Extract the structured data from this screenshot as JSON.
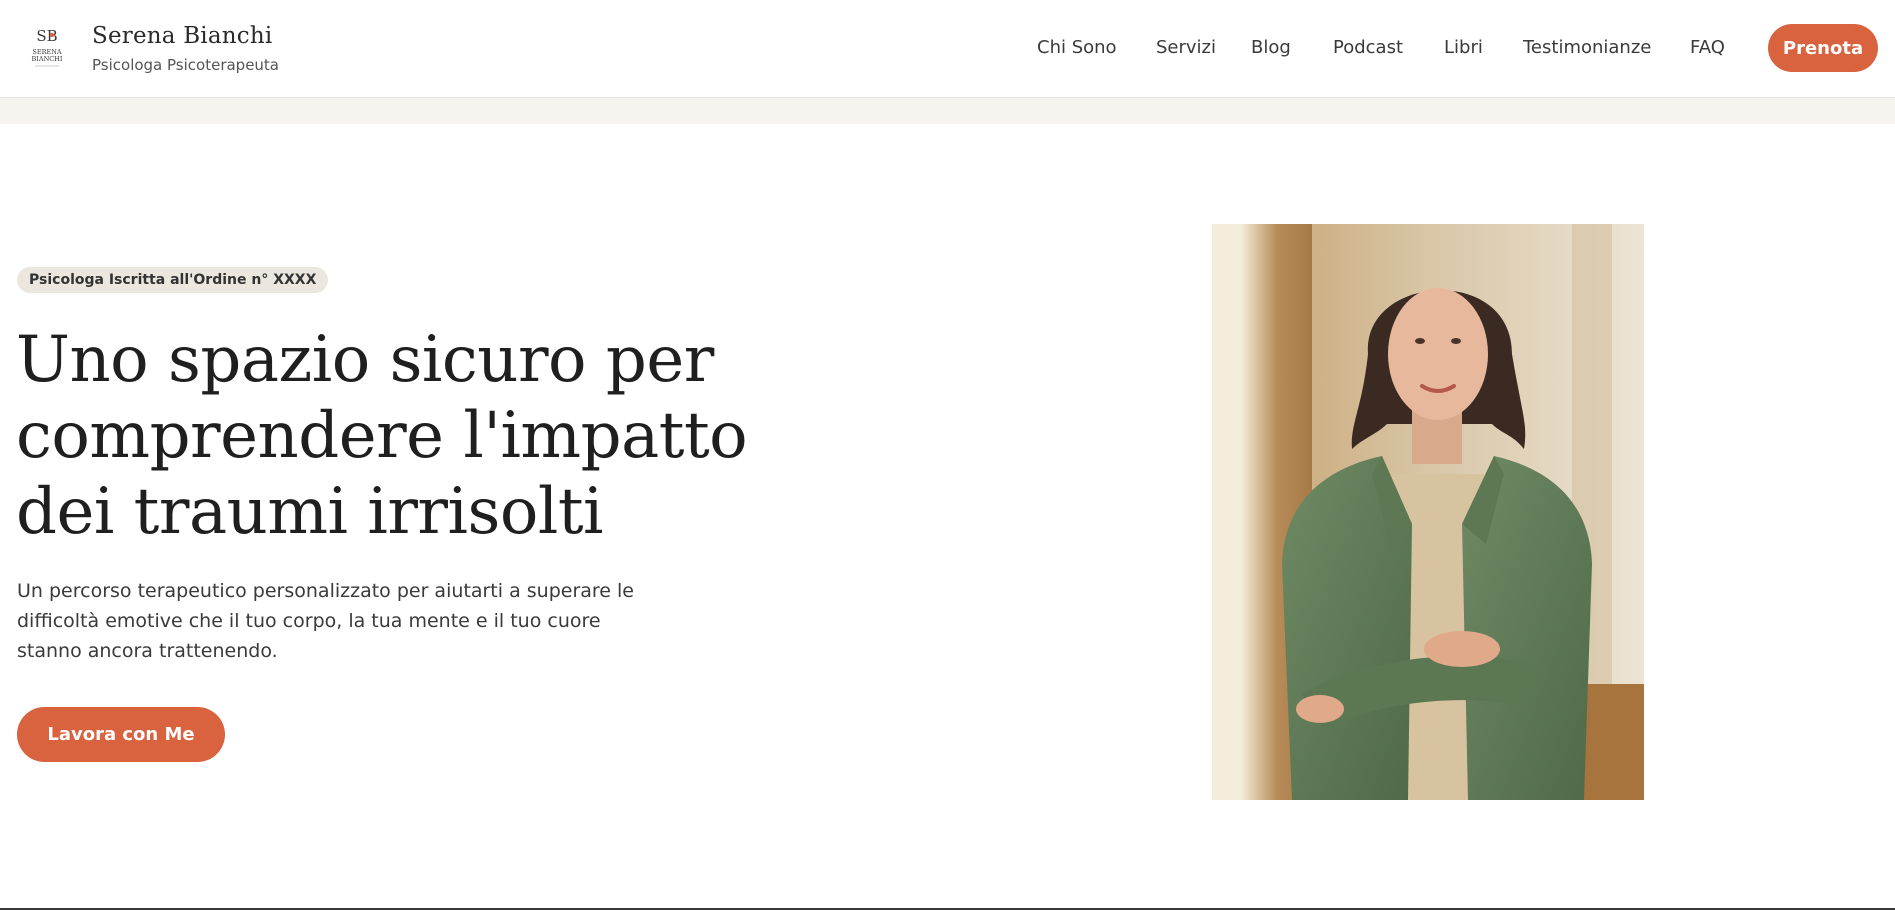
{
  "brand": {
    "name": "Serena Bianchi",
    "subtitle": "Psicologa Psicoterapeuta",
    "logo_letters": "SB",
    "logo_text_line1": "SERENA",
    "logo_text_line2": "BIANCHI",
    "logo_icon": "monogram-logo"
  },
  "nav": {
    "items": [
      {
        "label": "Chi Sono"
      },
      {
        "label": "Servizi"
      },
      {
        "label": "Blog"
      },
      {
        "label": "Podcast"
      },
      {
        "label": "Libri"
      },
      {
        "label": "Testimonianze"
      },
      {
        "label": "FAQ"
      }
    ],
    "cta_label": "Prenota"
  },
  "hero": {
    "badge": "Psicologa Iscritta all'Ordine n° XXXX",
    "title": "Uno spazio sicuro per comprendere l'impatto dei traumi irrisolti",
    "text": "Un percorso terapeutico personalizzato per aiutarti a superare le difficoltà emotive che il tuo corpo, la tua mente e il tuo cuore stanno ancora trattenendo.",
    "cta_label": "Lavora con Me",
    "image_subject": "portrait-photo"
  },
  "colors": {
    "accent": "#d9623f",
    "badge_bg": "#ebe7df",
    "strip_bg": "#f7f3ef",
    "text": "#1f1f1f"
  }
}
